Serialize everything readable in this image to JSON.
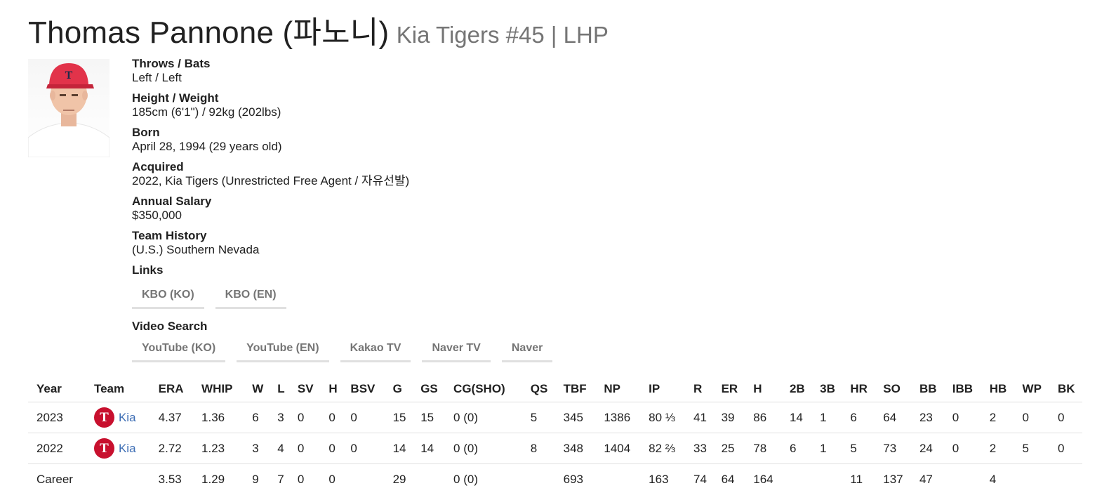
{
  "header": {
    "name": "Thomas Pannone (파노니)",
    "subtitle": "Kia Tigers #45 | LHP"
  },
  "profile": {
    "photo": "player-headshot",
    "fields": [
      {
        "label": "Throws / Bats",
        "value": "Left / Left"
      },
      {
        "label": "Height / Weight",
        "value": "185cm (6'1\") / 92kg (202lbs)"
      },
      {
        "label": "Born",
        "value": "April 28, 1994 (29 years old)"
      },
      {
        "label": "Acquired",
        "value": "2022, Kia Tigers (Unrestricted Free Agent / 자유선발)"
      },
      {
        "label": "Annual Salary",
        "value": "$350,000"
      },
      {
        "label": "Team History",
        "value": "(U.S.) Southern Nevada"
      }
    ],
    "links_label": "Links",
    "links": [
      "KBO (KO)",
      "KBO (EN)"
    ],
    "video_label": "Video Search",
    "videos": [
      "YouTube (KO)",
      "YouTube (EN)",
      "Kakao TV",
      "Naver TV",
      "Naver"
    ]
  },
  "stats": {
    "headers": [
      "Year",
      "Team",
      "ERA",
      "WHIP",
      "W",
      "L",
      "SV",
      "H",
      "BSV",
      "G",
      "GS",
      "CG(SHO)",
      "QS",
      "TBF",
      "NP",
      "IP",
      "R",
      "ER",
      "H",
      "2B",
      "3B",
      "HR",
      "SO",
      "BB",
      "IBB",
      "HB",
      "WP",
      "BK"
    ],
    "rows": [
      {
        "year": "2023",
        "team": "Kia",
        "cells": [
          "4.37",
          "1.36",
          "6",
          "3",
          "0",
          "0",
          "0",
          "15",
          "15",
          "0 (0)",
          "5",
          "345",
          "1386",
          "80 ⅓",
          "41",
          "39",
          "86",
          "14",
          "1",
          "6",
          "64",
          "23",
          "0",
          "2",
          "0",
          "0"
        ]
      },
      {
        "year": "2022",
        "team": "Kia",
        "cells": [
          "2.72",
          "1.23",
          "3",
          "4",
          "0",
          "0",
          "0",
          "14",
          "14",
          "0 (0)",
          "8",
          "348",
          "1404",
          "82 ⅔",
          "33",
          "25",
          "78",
          "6",
          "1",
          "5",
          "73",
          "24",
          "0",
          "2",
          "5",
          "0"
        ]
      },
      {
        "year": "Career",
        "team": "",
        "cells": [
          "3.53",
          "1.29",
          "9",
          "7",
          "0",
          "0",
          "",
          "29",
          "",
          "0 (0)",
          "",
          "693",
          "",
          "163",
          "74",
          "64",
          "164",
          "",
          "",
          "11",
          "137",
          "47",
          "",
          "4",
          "",
          ""
        ]
      }
    ],
    "team_logo_letter": "T",
    "team_color": "#c8102e",
    "link_color": "#3f6fb5"
  }
}
